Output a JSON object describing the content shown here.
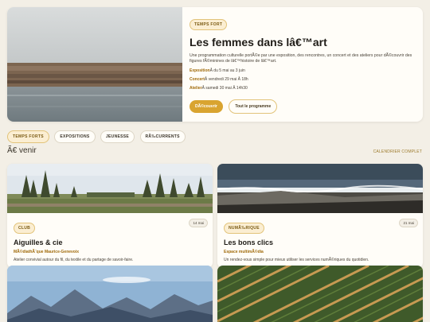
{
  "hero": {
    "tag": "TEMPS FORT",
    "title": "Les femmes dans lâ€™art",
    "description": "Une programmation culturelle portÃ©e par une exposition, des rencontres, un concert et des ateliers pour dÃ©couvrir des figures fÃ©minines de lâ€™histoire de lâ€™art.",
    "details": [
      {
        "label": "Exposition",
        "value": "Â  du 5 mai au 3 juin"
      },
      {
        "label": "Concert",
        "value": "Â  vendredi 29 mai Â  18h"
      },
      {
        "label": "Atelier",
        "value": "Â  samedi 30 mai Â  14h30"
      }
    ],
    "primary_button": "DÃ©couvrir",
    "secondary_button": "Tout le programme"
  },
  "filters": [
    "TEMPS FORTS",
    "EXPOSITIONS",
    "JEUNESSE",
    "RÃ‰CURRENTS"
  ],
  "section": {
    "title": "Ã€ venir",
    "link": "CALENDRIER COMPLET"
  },
  "cards": [
    {
      "tag": "CLUB",
      "date": "14 mai",
      "title": "Aiguilles & cie",
      "place": "MÃ©diathÃ¨que Maurice-Genevoix",
      "description": "Atelier convivial autour du fil, du textile et du partage de savoir-faire."
    },
    {
      "tag": "NUMÃ‰RIQUE",
      "date": "21 mai",
      "title": "Les bons clics",
      "place": "Espace multimÃ©dia",
      "description": "Un rendez-vous simple pour mieux utiliser les services numÃ©riques du quotidien."
    }
  ],
  "colors": {
    "background": "#f3efe6",
    "accent": "#d9a430",
    "accent_text": "#a06a0a"
  }
}
